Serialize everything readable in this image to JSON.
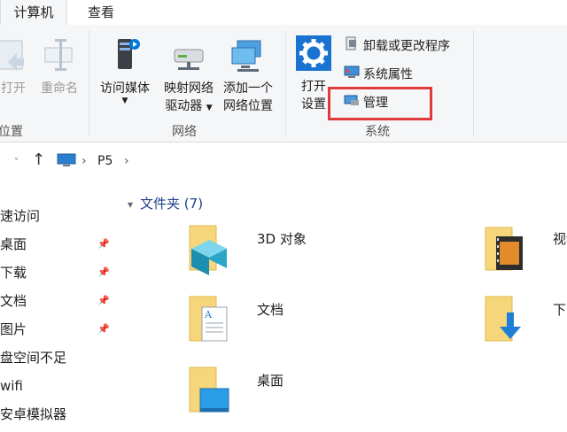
{
  "tabs": [
    {
      "label": "计算机"
    },
    {
      "label": "查看"
    }
  ],
  "ribbon": {
    "location_group": {
      "open_label": "打开",
      "rename_label": "重命名",
      "group_label": "位置"
    },
    "network_group": {
      "access_media": "访问媒体",
      "map_drive_line1": "映射网络",
      "map_drive_line2": "驱动器",
      "add_location_line1": "添加一个",
      "add_location_line2": "网络位置",
      "group_label": "网络"
    },
    "system_group": {
      "open_settings_line1": "打开",
      "open_settings_line2": "设置",
      "uninstall": "卸载或更改程序",
      "properties": "系统属性",
      "manage": "管理",
      "group_label": "系统"
    }
  },
  "address": {
    "back": "←",
    "forward": "→",
    "dropdown": "˅",
    "up": "↑",
    "separator": "›",
    "path": "P5"
  },
  "nav": {
    "items": [
      {
        "label": "速访问",
        "pinned": false
      },
      {
        "label": "桌面",
        "pinned": true
      },
      {
        "label": "下载",
        "pinned": true
      },
      {
        "label": "文档",
        "pinned": true
      },
      {
        "label": "图片",
        "pinned": true
      },
      {
        "label": "盘空间不足",
        "pinned": false
      },
      {
        "label": "wifi",
        "pinned": false
      },
      {
        "label": "安卓模拟器",
        "pinned": false
      }
    ]
  },
  "content": {
    "section_title": "文件夹 (7)",
    "folders": [
      {
        "name": "3D 对象",
        "icon": "3d-objects-folder-icon"
      },
      {
        "name": "视频",
        "icon": "videos-folder-icon"
      },
      {
        "name": "文档",
        "icon": "documents-folder-icon"
      },
      {
        "name": "下载",
        "icon": "downloads-folder-icon"
      },
      {
        "name": "桌面",
        "icon": "desktop-folder-icon"
      }
    ]
  },
  "colors": {
    "highlight": "#e03a3a",
    "accent": "#0078d7",
    "folder": "#f6d67a"
  }
}
